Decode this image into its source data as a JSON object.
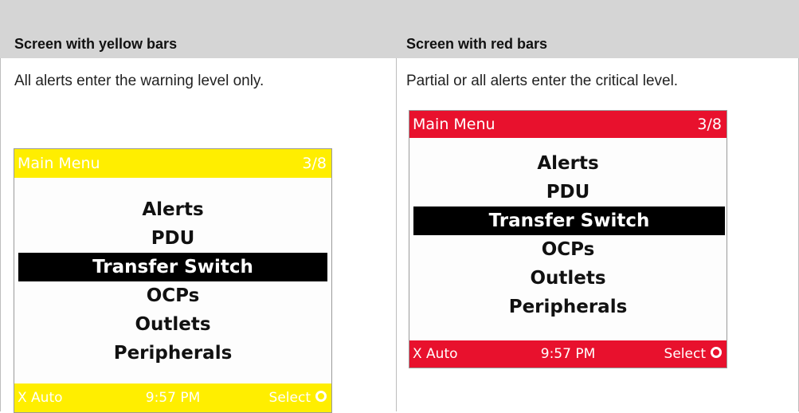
{
  "table": {
    "headers": [
      "Screen with yellow bars",
      "Screen with red bars"
    ],
    "rows": [
      {
        "left_text": "All alerts enter the warning level only.",
        "right_text": "Partial or all alerts enter the critical level."
      }
    ]
  },
  "screens": {
    "yellow": {
      "bar_color": "#ffee00",
      "title": "Main  Menu",
      "page": "3/8",
      "menu_items": [
        "Alerts",
        "PDU",
        "Transfer Switch",
        "OCPs",
        "Outlets",
        "Peripherals"
      ],
      "selected_index": 2,
      "footer": {
        "left": "X Auto",
        "center": "9:57 PM",
        "right": "Select"
      },
      "select_icon": "select-circle-icon"
    },
    "red": {
      "bar_color": "#e8112d",
      "title": "Main  Menu",
      "page": "3/8",
      "menu_items": [
        "Alerts",
        "PDU",
        "Transfer Switch",
        "OCPs",
        "Outlets",
        "Peripherals"
      ],
      "selected_index": 2,
      "footer": {
        "left": "X Auto",
        "center": "9:57 PM",
        "right": "Select"
      },
      "select_icon": "select-circle-icon"
    }
  }
}
